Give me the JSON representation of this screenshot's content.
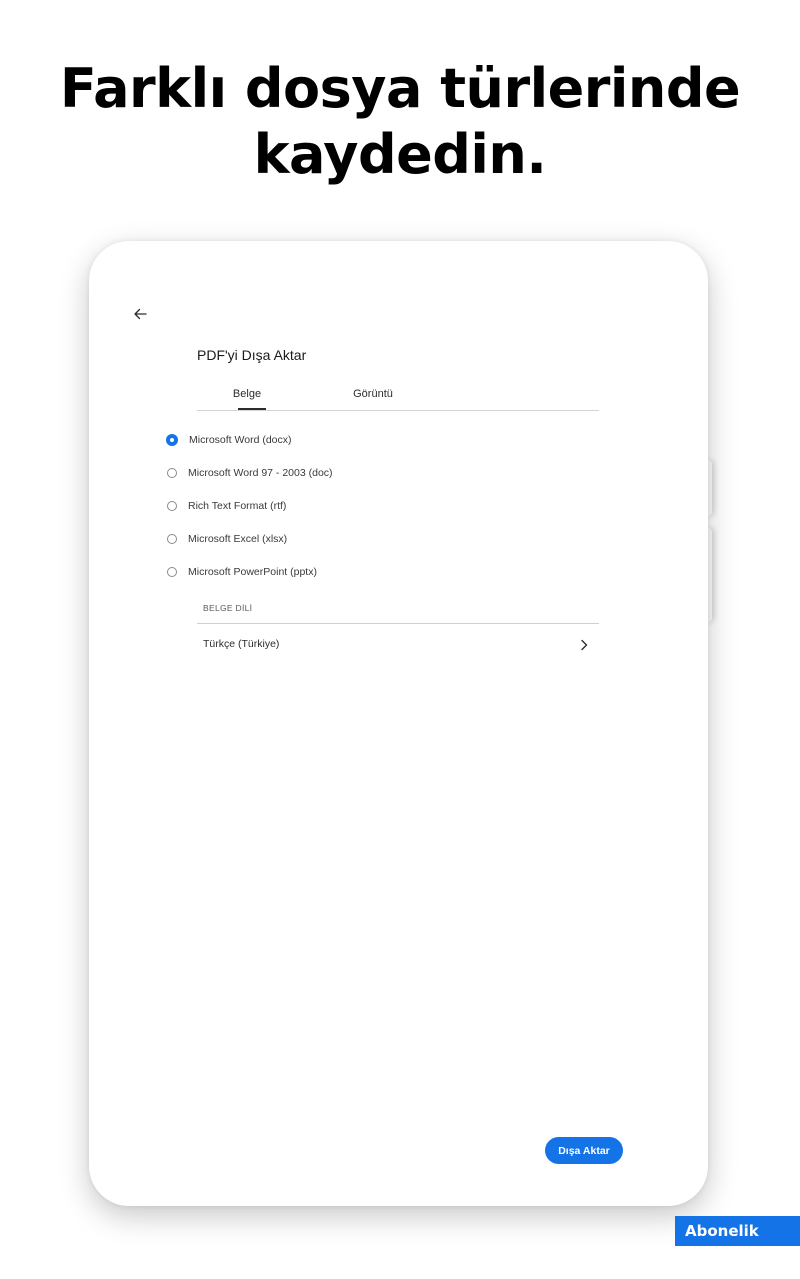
{
  "headline": {
    "line1": "Farklı dosya türlerinde",
    "line2": "kaydedin."
  },
  "tablet": {
    "back_icon": "arrow-left-icon",
    "dialog_title": "PDF'yi Dışa Aktar",
    "tabs": [
      {
        "label": "Belge",
        "selected": true
      },
      {
        "label": "Görüntü",
        "selected": false
      }
    ],
    "formats": [
      {
        "label": "Microsoft Word (docx)",
        "selected": true
      },
      {
        "label": "Microsoft Word 97 - 2003 (doc)",
        "selected": false
      },
      {
        "label": "Rich Text Format (rtf)",
        "selected": false
      },
      {
        "label": "Microsoft Excel (xlsx)",
        "selected": false
      },
      {
        "label": "Microsoft PowerPoint (pptx)",
        "selected": false
      }
    ],
    "language_section": {
      "header": "BELGE DİLİ",
      "value": "Türkçe (Türkiye)",
      "chevron_icon": "chevron-right-icon"
    },
    "export_button": "Dışa Aktar"
  },
  "badge": {
    "label": "Abonelik"
  },
  "colors": {
    "accent": "#1473e6",
    "text": "#2c2c2c",
    "divider": "#d4d4d4"
  }
}
